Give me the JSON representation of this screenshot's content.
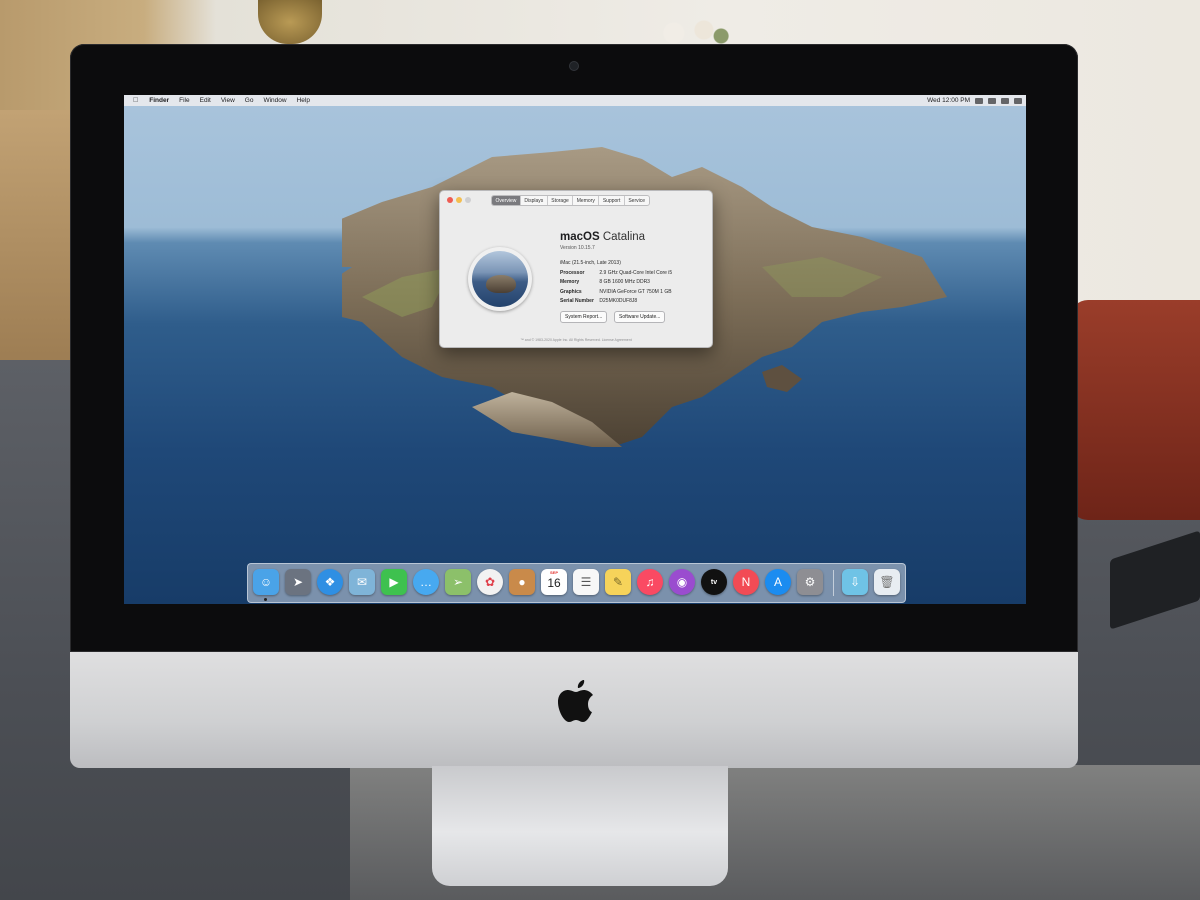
{
  "menubar": {
    "items": [
      "Finder",
      "File",
      "Edit",
      "View",
      "Go",
      "Window",
      "Help"
    ],
    "clock": "Wed 12:00 PM"
  },
  "about_window": {
    "tabs": [
      "Overview",
      "Displays",
      "Storage",
      "Memory",
      "Support",
      "Service"
    ],
    "active_tab": "Overview",
    "os_name_bold": "macOS",
    "os_name_light": "Catalina",
    "version": "Version 10.15.7",
    "model": "iMac (21.5-inch, Late 2013)",
    "specs": [
      {
        "key": "Processor",
        "value": "2.9 GHz Quad-Core Intel Core i5"
      },
      {
        "key": "Memory",
        "value": "8 GB 1600 MHz DDR3"
      },
      {
        "key": "Graphics",
        "value": "NVIDIA GeForce GT 750M 1 GB"
      },
      {
        "key": "Serial Number",
        "value": "D25MK0DUF8J8"
      }
    ],
    "buttons": {
      "system_report": "System Report...",
      "software_update": "Software Update..."
    },
    "footer": "™ and © 1983-2020 Apple Inc. All Rights Reserved. License Agreement"
  },
  "dock": {
    "calendar_month": "SEP",
    "calendar_day": "16",
    "tv_label": "tv",
    "apps": [
      {
        "name": "finder-icon",
        "color": "#4aa3e8"
      },
      {
        "name": "launchpad-icon",
        "color": "#6b7380"
      },
      {
        "name": "safari-icon",
        "color": "#2f8fe3"
      },
      {
        "name": "mail-icon",
        "color": "#7fb4d8"
      },
      {
        "name": "facetime-icon",
        "color": "#3ec14f"
      },
      {
        "name": "messages-icon",
        "color": "#47a9f0"
      },
      {
        "name": "maps-icon",
        "color": "#8cc06a"
      },
      {
        "name": "photos-icon",
        "color": "#f2f2f2"
      },
      {
        "name": "contacts-icon",
        "color": "#c98a4a"
      },
      {
        "name": "calendar-icon",
        "color": "#ffffff"
      },
      {
        "name": "reminders-icon",
        "color": "#f7f7f7"
      },
      {
        "name": "notes-icon",
        "color": "#f6d35a"
      },
      {
        "name": "music-icon",
        "color": "#fa4a63"
      },
      {
        "name": "podcasts-icon",
        "color": "#9a4ccf"
      },
      {
        "name": "apple-tv-icon",
        "color": "#111111"
      },
      {
        "name": "news-icon",
        "color": "#f24b55"
      },
      {
        "name": "app-store-icon",
        "color": "#1b8cf0"
      },
      {
        "name": "system-preferences-icon",
        "color": "#8e8e93"
      },
      {
        "name": "downloads-folder-icon",
        "color": "#6fc3e6"
      },
      {
        "name": "trash-icon",
        "color": "#e8edf2"
      }
    ]
  }
}
